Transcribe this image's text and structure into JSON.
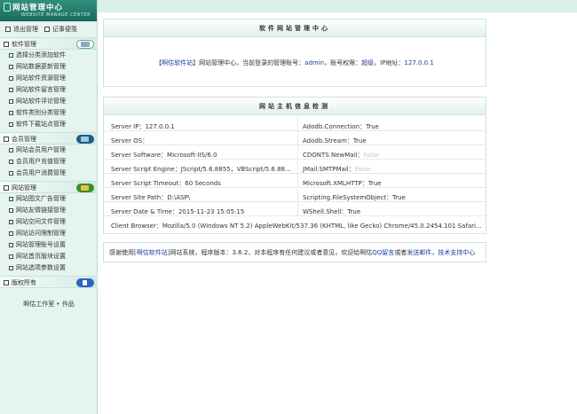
{
  "sidebar": {
    "logo_title": "网站管理中心",
    "logo_subtitle": "WEBSITE MANAGE CENTER",
    "top_actions": [
      "退出管理",
      "记事便笺"
    ],
    "sections": [
      {
        "title": "软件管理",
        "items": [
          "选择分类添加软件",
          "网站数据更新管理",
          "网站软件资源管理",
          "网站软件留言管理",
          "网站软件评论管理",
          "软件类别分类管理",
          "软件下载站点管理"
        ]
      },
      {
        "title": "会员管理",
        "items": [
          "网站会员用户管理",
          "会员用户充值管理",
          "会员用户消费管理"
        ]
      },
      {
        "title": "网站管理",
        "items": [
          "网站图文广告管理",
          "网站友情链接管理",
          "网站空间文件管理",
          "网站访问限制管理",
          "网站管理账号设置",
          "网站首页版块设置",
          "网站选项参数设置"
        ]
      },
      {
        "title": "版权所有",
        "items": []
      }
    ],
    "footer": "啊估工作室 • 作品"
  },
  "panel1": {
    "title": "软件网站管理中心",
    "site_link": "【啊估软件站】",
    "text1": "网站管理中心，当前登录的管理账号：",
    "account": "admin",
    "text2": "，账号权限：",
    "role": "超级",
    "text3": "，IP地址：",
    "ip": "127.0.0.1"
  },
  "panel2": {
    "title": "网站主机信息检测",
    "rows": [
      [
        {
          "text": "Server IP：127.0.0.1",
          "dim": false
        },
        {
          "text": "Adodb.Connection：True",
          "dim": false
        }
      ],
      [
        {
          "text": "Server OS：",
          "dim": false
        },
        {
          "text": "Adodb.Stream：True",
          "dim": false
        }
      ],
      [
        {
          "text": "Server Software：Microsoft-IIS/6.0",
          "dim": false
        },
        {
          "text": "CDONTS.NewMail：",
          "dim": false,
          "extra": "False"
        }
      ],
      [
        {
          "text": "Server Script Engine：JScript/5.6.8855，VBScript/5.6.88...",
          "dim": false
        },
        {
          "text": "JMail.SMTPMail：",
          "dim": false,
          "extra": "False"
        }
      ],
      [
        {
          "text": "Server Script Timeout：60 Seconds",
          "dim": false
        },
        {
          "text": "Microsoft.XMLHTTP：True",
          "dim": false
        }
      ],
      [
        {
          "text": "Server Site Path：D:\\ASP\\",
          "dim": false
        },
        {
          "text": "Scripting.FileSystemObject：True",
          "dim": false
        }
      ],
      [
        {
          "text": "Server Date & Time：2015-11-23 15:05:15",
          "dim": false
        },
        {
          "text": "WShell.Shell：True",
          "dim": false
        }
      ]
    ],
    "browser": "Client Browser：Mozilla/5.0 (Windows NT 5.2) AppleWebKit/537.36 (KHTML, like Gecko) Chrome/45.0.2454.101 Safari..."
  },
  "panel3": {
    "t1": "感谢使用",
    "site": "[啊估软件站]",
    "t2": "网站系统，程序版本：3.6.2，对本程序有任何建议或者意见，欢迎给啊估",
    "qq": "QQ留言",
    "t3": "或者",
    "mail": "发送邮件",
    "t4": "，",
    "support": "技术支持中心"
  }
}
